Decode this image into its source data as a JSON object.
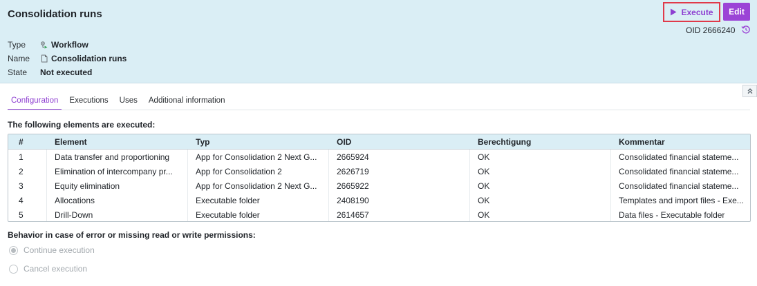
{
  "header": {
    "title": "Consolidation runs",
    "oid": "OID 2666240",
    "execute_label": "Execute",
    "edit_label": "Edit",
    "accent_color": "#9b44d6",
    "highlight_color": "#e03a4a",
    "background_color": "#daeef5"
  },
  "meta": {
    "type_label": "Type",
    "type_value": "Workflow",
    "type_icon": "workflow-icon",
    "name_label": "Name",
    "name_value": "Consolidation runs",
    "name_icon": "document-icon",
    "state_label": "State",
    "state_value": "Not executed"
  },
  "tabs": [
    {
      "label": "Configuration",
      "active": true
    },
    {
      "label": "Executions",
      "active": false
    },
    {
      "label": "Uses",
      "active": false
    },
    {
      "label": "Additional information",
      "active": false
    }
  ],
  "section_title": "The following elements are executed:",
  "table": {
    "columns": [
      "#",
      "Element",
      "Typ",
      "OID",
      "Berechtigung",
      "Kommentar"
    ],
    "rows": [
      [
        "1",
        "Data transfer and proportioning",
        "App for Consolidation 2 Next G...",
        "2665924",
        "OK",
        "Consolidated financial stateme..."
      ],
      [
        "2",
        "Elimination of intercompany pr...",
        "App for Consolidation 2",
        "2626719",
        "OK",
        "Consolidated financial stateme..."
      ],
      [
        "3",
        "Equity elimination",
        "App for Consolidation 2 Next G...",
        "2665922",
        "OK",
        "Consolidated financial stateme..."
      ],
      [
        "4",
        "Allocations",
        "Executable folder",
        "2408190",
        "OK",
        "Templates and import files - Exe..."
      ],
      [
        "5",
        "Drill-Down",
        "Executable folder",
        "2614657",
        "OK",
        "Data files - Executable folder"
      ]
    ]
  },
  "behavior": {
    "title": "Behavior in case of error or missing read or write permissions:",
    "options": [
      {
        "label": "Continue execution",
        "checked": true
      },
      {
        "label": "Cancel execution",
        "checked": false
      }
    ]
  }
}
